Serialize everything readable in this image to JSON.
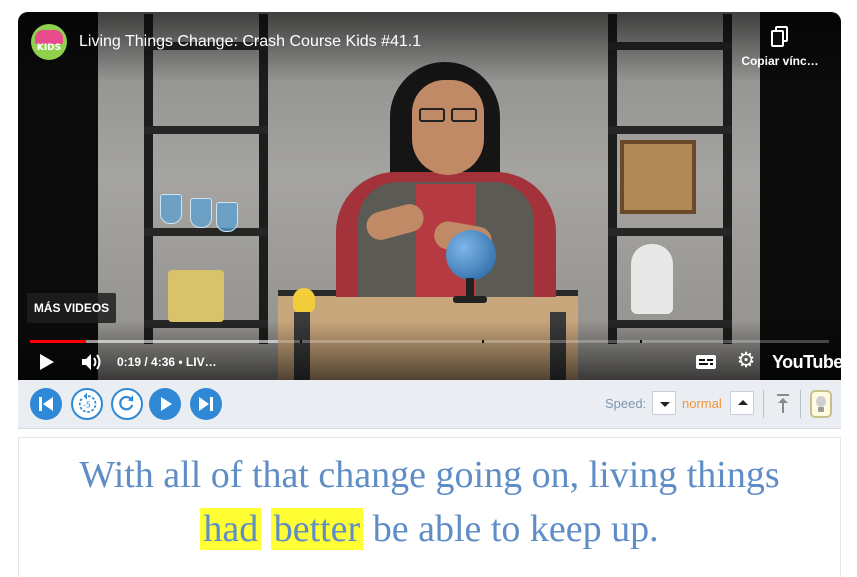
{
  "player": {
    "video_title": "Living Things Change: Crash Course Kids #41.1",
    "channel_logo_text": "KIDS",
    "copy_link_label": "Copiar vínc…",
    "more_videos_label": "MÁS VIDEOS",
    "time_text": "0:19 / 4:36 • LIV…",
    "youtube_label": "YouTube",
    "progress_played_percent": 7,
    "progress_loaded_percent": 31,
    "icons": [
      "copy-icon",
      "play-icon",
      "volume-icon",
      "captions-icon",
      "gear-icon"
    ]
  },
  "toolbar": {
    "speed_label": "Speed:",
    "speed_value": "normal",
    "colors": {
      "accent": "#2f89d6",
      "speed_value": "#f0963a",
      "background": "#eaeef2"
    },
    "buttons": [
      "skip-back",
      "replay-5",
      "repeat",
      "play",
      "skip-forward",
      "back-to-top",
      "hint"
    ]
  },
  "caption": {
    "line1": "With all of that change going on, living things",
    "word_highlight_1": "had",
    "word_highlight_2": "better",
    "line2_rest": "be able to keep up.",
    "text_color": "#5f8dc6",
    "highlight_color": "#ffff33"
  }
}
